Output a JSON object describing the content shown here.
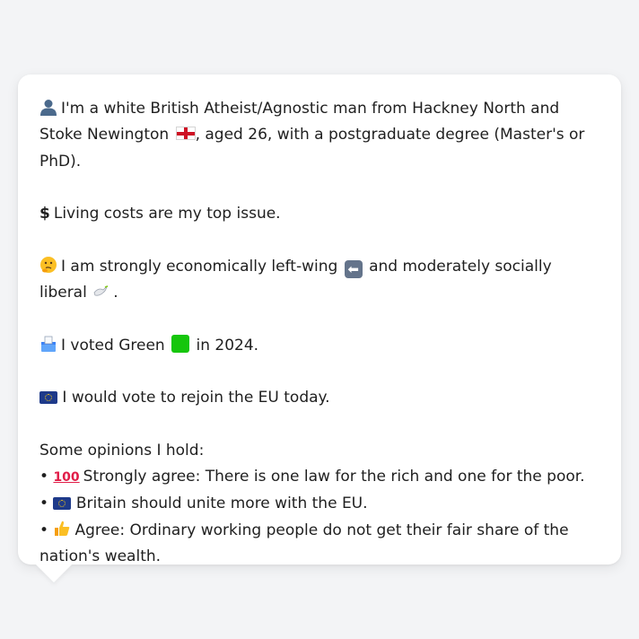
{
  "profile": {
    "identity": {
      "icon": "person-silhouette-icon",
      "text_part1": "I'm a white British Atheist/Agnostic man from Hackney North and Stoke Newington",
      "flag_icon": "england-flag-icon",
      "text_part2": ", aged 26, with a postgraduate degree (Master's or PhD)."
    },
    "top_issue": {
      "icon": "dollar-sign-icon",
      "text": "Living costs are my top issue."
    },
    "ideology": {
      "icon": "thinking-face-icon",
      "text_part1": "I am strongly economically left-wing",
      "arrow_icon": "left-arrow-icon",
      "text_part2": "and moderately socially liberal",
      "dove_icon": "dove-icon",
      "text_part3": "."
    },
    "vote": {
      "icon": "ballot-box-icon",
      "text_part1": "I voted Green",
      "square_icon": "green-square-icon",
      "text_part2": "in 2024."
    },
    "eu": {
      "icon": "eu-flag-icon",
      "text": "I would vote to rejoin the EU today."
    },
    "opinions_title": "Some opinions I hold:",
    "opinions": [
      {
        "bullet": "•",
        "icon": "hundred-points-icon",
        "text": "Strongly agree: There is one law for the rich and one for the poor."
      },
      {
        "bullet": "•",
        "icon": "eu-flag-icon",
        "text": "Britain should unite more with the EU."
      },
      {
        "bullet": "•",
        "icon": "thumbs-up-icon",
        "text": "Agree: Ordinary working people do not get their fair share of the nation's wealth."
      }
    ]
  },
  "colors": {
    "background": "#f3f4f6",
    "bubble": "#ffffff",
    "text": "#1f1f1f",
    "green_square": "#16c60c",
    "eu_blue": "#1e3a8a"
  }
}
